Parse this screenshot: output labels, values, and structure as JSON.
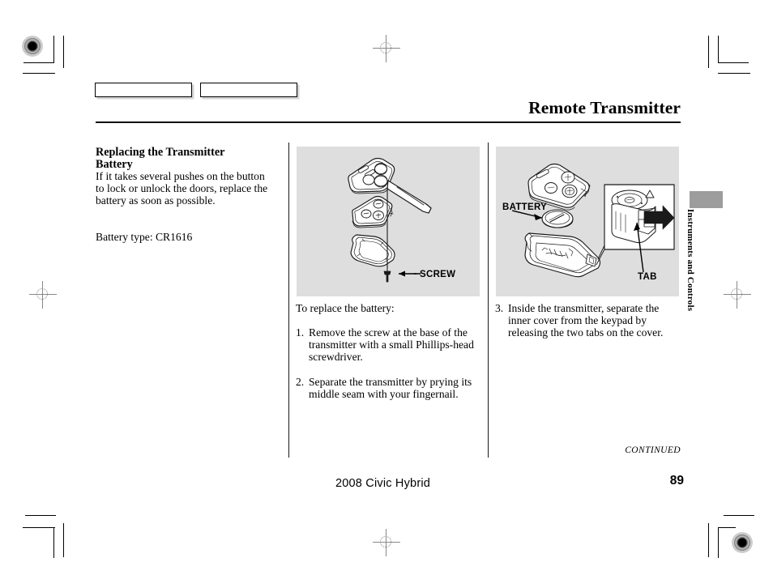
{
  "document": {
    "header_title": "Remote Transmitter",
    "side_section_label": "Instruments and Controls",
    "continued_note": "CONTINUED",
    "footer_model": "2008  Civic  Hybrid",
    "page_number": "89"
  },
  "left_column": {
    "heading_line1": "Replacing the Transmitter",
    "heading_line2": "Battery",
    "paragraph": "If it takes several pushes on the button to lock or unlock the doors, replace the battery as soon as possible.",
    "battery_type": "Battery type: CR1616"
  },
  "middle_column": {
    "figure": {
      "caption_label": "SCREW",
      "background_color": "#dedede",
      "description": "Exploded view of remote transmitter key: upper housing with buttons and key blade, inner keypad cover, lower housing, and retaining screw"
    },
    "intro": "To replace the battery:",
    "steps": [
      {
        "number": "1.",
        "text": "Remove the screw at the base of the transmitter with a small Phillips-head screwdriver."
      },
      {
        "number": "2.",
        "text": "Separate the transmitter by prying its middle seam with your fingernail."
      }
    ]
  },
  "right_column": {
    "figure": {
      "label_battery": "BATTERY",
      "label_tab": "TAB",
      "background_color": "#dedede",
      "description": "Exploded view showing inner cover, CR1616 coin battery and lower housing, with detail callout box showing tab release direction arrow"
    },
    "steps": [
      {
        "number": "3.",
        "text": "Inside the transmitter, separate the inner cover from the keypad by releasing the two tabs on the cover."
      }
    ]
  },
  "top_tabs": {
    "tab1_label": "",
    "tab2_label": ""
  },
  "print_marks": {
    "registration_target": "registration-target-icon",
    "registration_cross": "registration-crosshair-icon"
  }
}
